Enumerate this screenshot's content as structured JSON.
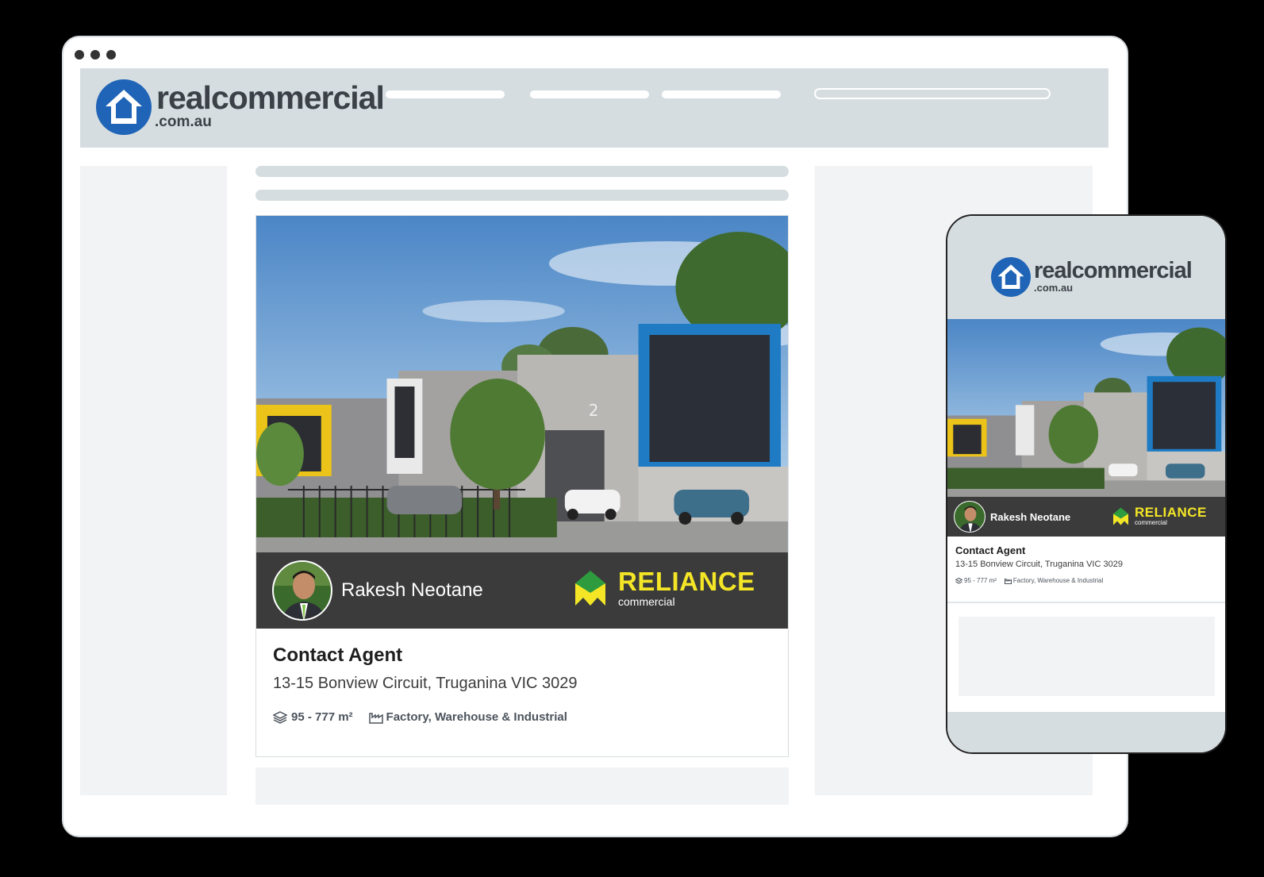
{
  "brand": {
    "name": "realcommercial",
    "domain": ".com.au",
    "color": "#1f64b6"
  },
  "listing": {
    "agent_name": "Rakesh Neotane",
    "agency_name": "RELIANCE",
    "agency_sub": "commercial",
    "price": "Contact Agent",
    "address": "13-15 Bonview Circuit, Truganina VIC 3029",
    "area": "95 - 777 m²",
    "property_type": "Factory, Warehouse & Industrial",
    "unit_number": "2"
  },
  "colors": {
    "header_bg": "#d6dde1",
    "agent_bar": "#3b3b3b",
    "agency_accent": "#f4e626",
    "agency_green": "#2e9b3e"
  },
  "icons": {
    "area": "layers-icon",
    "type": "factory-icon",
    "brand": "house-icon"
  }
}
